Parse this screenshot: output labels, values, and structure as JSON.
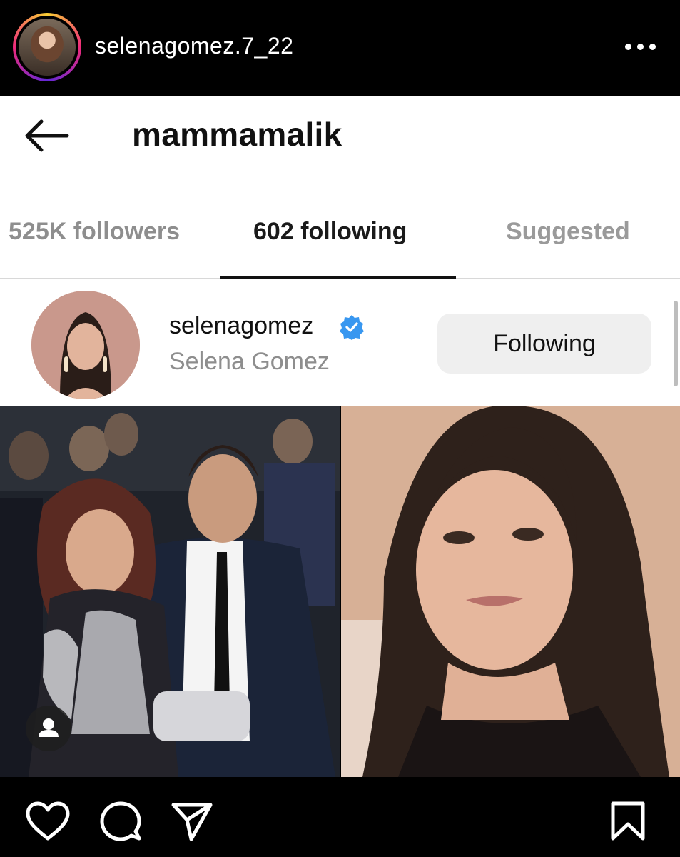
{
  "header": {
    "username": "selenagomez.7_22",
    "avatar_icon": "profile-avatar",
    "more_icon": "more-horizontal-icon"
  },
  "screenshot": {
    "back_icon": "arrow-left-icon",
    "profile_title": "mammamalik",
    "tabs": [
      {
        "label": "525K followers",
        "active": false
      },
      {
        "label": "602 following",
        "active": true
      },
      {
        "label": "Suggested",
        "active": false
      }
    ],
    "account_row": {
      "username": "selenagomez",
      "full_name": "Selena Gomez",
      "verified": true,
      "button_label": "Following"
    }
  },
  "photos": [
    {
      "name": "left-photo"
    },
    {
      "name": "right-photo"
    }
  ],
  "actions": {
    "like_icon": "heart-icon",
    "comment_icon": "comment-icon",
    "share_icon": "send-icon",
    "save_icon": "bookmark-icon",
    "tag_icon": "person-tag-icon"
  },
  "colors": {
    "verified": "#3897f0",
    "background": "#000000",
    "button_bg": "#efefef"
  }
}
